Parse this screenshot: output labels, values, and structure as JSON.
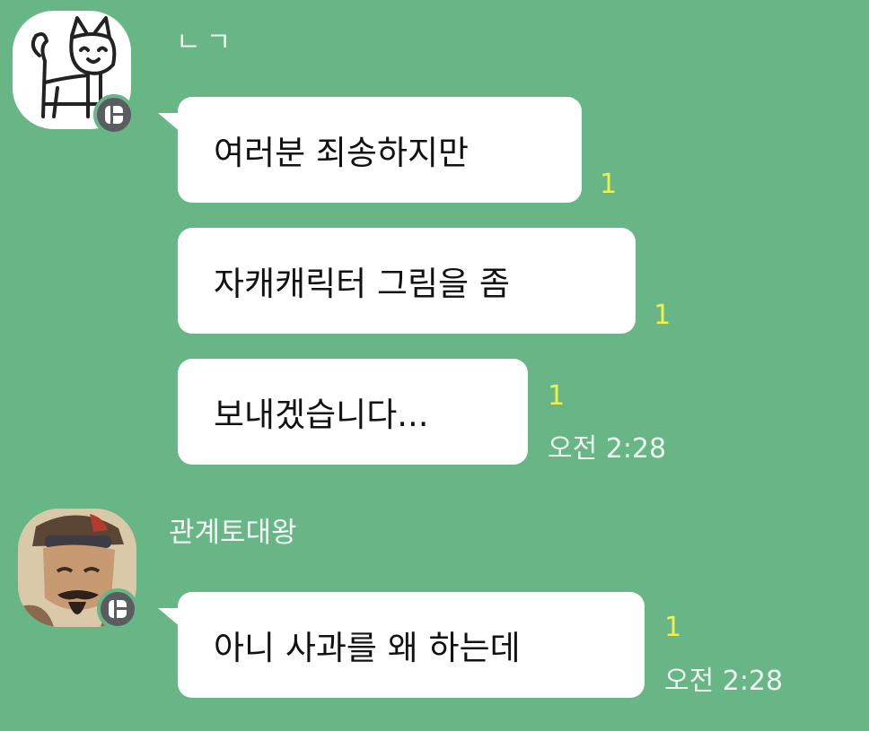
{
  "colors": {
    "background": "#68b585",
    "bubble": "#ffffff",
    "unread": "#f2ef4a",
    "badge": "#5a5d5f"
  },
  "messages_group1": {
    "sender": "ㄴㄱ",
    "avatar_icon": "cat-drawing-icon",
    "bubbles": [
      {
        "text": "여러분 죄송하지만",
        "unread": "1"
      },
      {
        "text": "자캐캐릭터 그림을 좀",
        "unread": "1"
      },
      {
        "text": "보내겠습니다...",
        "unread": "1",
        "time": "오전 2:28"
      }
    ]
  },
  "messages_group2": {
    "sender": "관계토대왕",
    "avatar_icon": "king-portrait-icon",
    "bubbles": [
      {
        "text": "아니 사과를 왜 하는데",
        "unread": "1",
        "time": "오전 2:28"
      }
    ]
  }
}
